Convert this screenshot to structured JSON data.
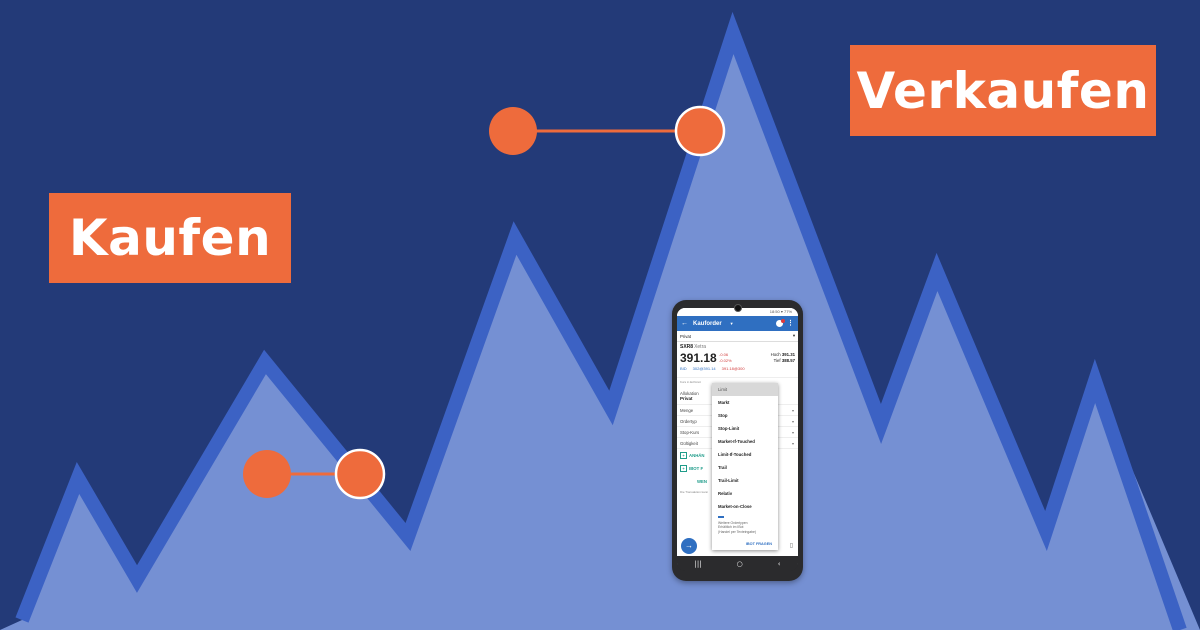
{
  "banner": {
    "buy_label": "Kaufen",
    "sell_label": "Verkaufen",
    "colors": {
      "background": "#233a78",
      "mountain_fill": "#7590d3",
      "mountain_stroke": "#3c62c4",
      "accent": "#ee6b3c"
    }
  },
  "phone": {
    "status_text": "18:50 ▾ 77%",
    "app_bar": {
      "title": "Kauforder"
    },
    "account": "Privat",
    "quote": {
      "symbol": "SXR8",
      "exchange": "Xetra",
      "price": "391.18",
      "change_abs": "-0.06",
      "change_pct": "-0.02%",
      "high_label": "Hoch",
      "high_value": "391.31",
      "low_label": "Tief",
      "low_value": "388.57",
      "bid_label": "BID",
      "bid_value": "302@391.14",
      "ask_value": "391.18@300"
    },
    "info_line": "Kurs in Echtzeit",
    "fields": {
      "allocation_label": "Allokation",
      "allocation_value": "Privat",
      "quantity_label": "Menge",
      "order_type_label": "Ordertyp",
      "stop_price_label": "Stop-Kurs",
      "validity_label": "Gültigkeit"
    },
    "links": {
      "attach": "ANHÄN",
      "ibot": "IBOT F",
      "send": "WEN"
    },
    "note": "Die Transaktion kann",
    "dropdown": {
      "options": [
        "Limit",
        "Markt",
        "Stop",
        "Stop-Limit",
        "Market-If-Touched",
        "Limit-If-Touched",
        "Trail",
        "Trail-Limit",
        "Relativ",
        "Market-on-Close"
      ],
      "selected": "Limit",
      "more_text_1": "Weitere Ordertypen",
      "more_text_2": "Erhältlich im IBot",
      "more_text_3": "(Handel per Texteingabe)",
      "ibot_button": "IBOT FRAGEN"
    }
  }
}
